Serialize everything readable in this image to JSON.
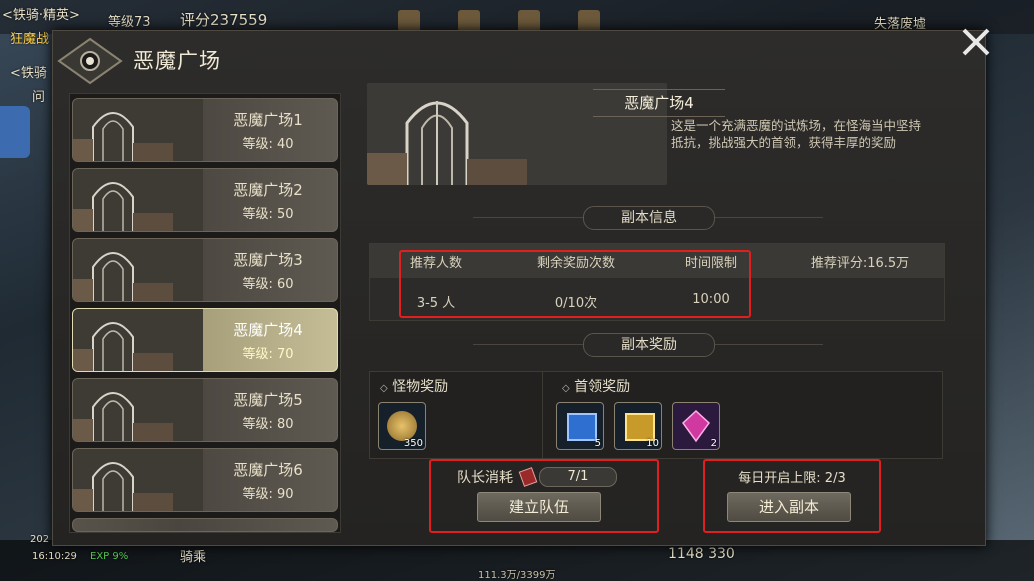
{
  "hud": {
    "name1": "<铁骑·精英>",
    "name2": "狂魔战",
    "name3": "<铁骑",
    "name4": "问",
    "level_text": "等级73",
    "score_text": "评分237559",
    "zone": "失落废墟",
    "time": "16:10:29",
    "year": "202",
    "exp": "EXP 9%",
    "mount": "骑乘",
    "coords": "1148 330",
    "progress": "111.3万/3399万"
  },
  "dialog": {
    "title": "恶魔广场"
  },
  "dungeons": [
    {
      "name": "恶魔广场1",
      "level": "等级: 40",
      "selected": false
    },
    {
      "name": "恶魔广场2",
      "level": "等级: 50",
      "selected": false
    },
    {
      "name": "恶魔广场3",
      "level": "等级: 60",
      "selected": false
    },
    {
      "name": "恶魔广场4",
      "level": "等级: 70",
      "selected": true
    },
    {
      "name": "恶魔广场5",
      "level": "等级: 80",
      "selected": false
    },
    {
      "name": "恶魔广场6",
      "level": "等级: 90",
      "selected": false
    }
  ],
  "detail": {
    "name": "恶魔广场4",
    "description": "这是一个充满恶魔的试炼场，在怪海当中坚持抵抗，挑战强大的首领，获得丰厚的奖励",
    "info_header": "副本信息",
    "rewards_header": "副本奖励",
    "table": {
      "headers": [
        "推荐人数",
        "剩余奖励次数",
        "时间限制"
      ],
      "values": [
        "3-5 人",
        "0/10次",
        "10:00"
      ],
      "recommended_score": "推荐评分:16.5万"
    },
    "monster_rewards_label": "怪物奖励",
    "boss_rewards_label": "首领奖励",
    "monster_items": [
      {
        "icon": "gold-coin-icon",
        "count": "350",
        "color": "#c79a3a"
      }
    ],
    "boss_items": [
      {
        "icon": "blue-treasure-box-icon",
        "count": "5",
        "color": "#2f6fd0"
      },
      {
        "icon": "gold-treasure-box-icon",
        "count": "10",
        "color": "#d8b030"
      },
      {
        "icon": "crystal-icon",
        "count": "2",
        "color": "#d03aa0"
      }
    ]
  },
  "actions": {
    "leader_cost_label": "队长消耗",
    "leader_cost_value": "7/1",
    "create_team": "建立队伍",
    "daily_limit": "每日开启上限: 2/3",
    "enter": "进入副本"
  },
  "colors": {
    "highlight_box": "#e0201e",
    "selected_item": "#b6b08c"
  }
}
